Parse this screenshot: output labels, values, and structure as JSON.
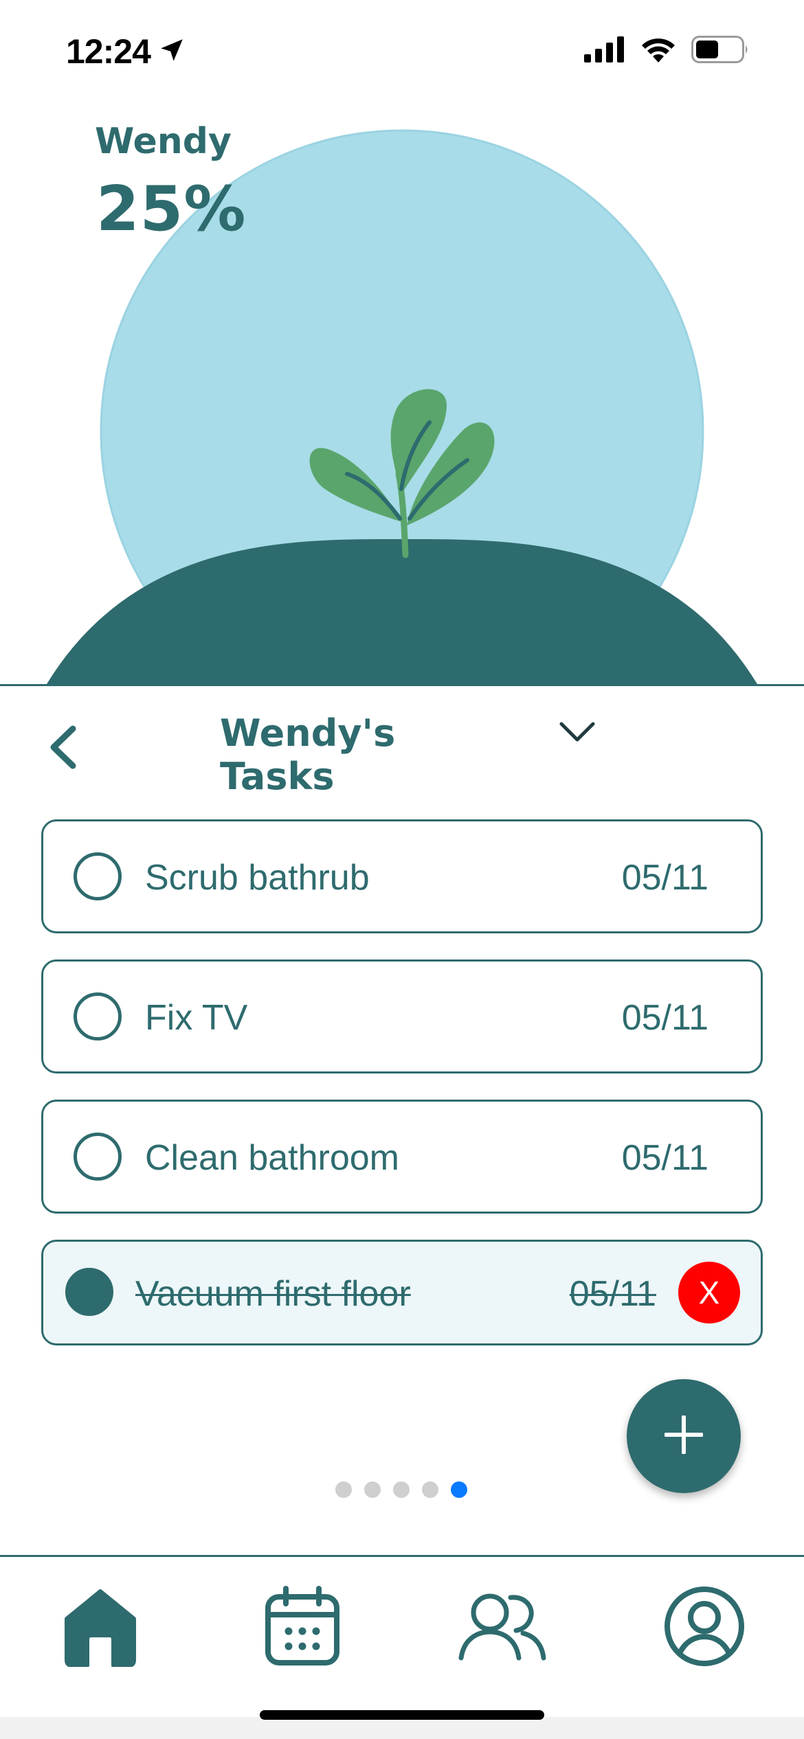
{
  "status_bar": {
    "time": "12:24",
    "icons": [
      "location-arrow-icon",
      "cellular-signal-icon",
      "wifi-icon",
      "battery-icon"
    ]
  },
  "profile": {
    "name": "Wendy",
    "progress_percent_label": "25%",
    "progress_fraction": 0.25
  },
  "tasks_header": {
    "title": "Wendy's Tasks",
    "back_icon": "chevron-left-icon",
    "dropdown_icon": "chevron-down-icon"
  },
  "tasks": [
    {
      "label": "Scrub bathrub",
      "date": "05/11",
      "completed": false
    },
    {
      "label": "Fix TV",
      "date": "05/11",
      "completed": false
    },
    {
      "label": "Clean bathroom",
      "date": "05/11",
      "completed": false
    },
    {
      "label": "Vacuum first floor",
      "date": "05/11",
      "completed": true,
      "delete_label": "X"
    }
  ],
  "pagination": {
    "count": 5,
    "active_index": 4
  },
  "fab": {
    "icon": "plus-icon"
  },
  "tab_bar": {
    "tabs": [
      "home-icon",
      "calendar-icon",
      "group-icon",
      "profile-icon"
    ],
    "active": "home-icon"
  },
  "colors": {
    "primary": "#2e6b6e",
    "sky": "#a8dce8",
    "leaf": "#5aa56c",
    "delete": "#ff0000",
    "active_dot": "#0a7aff"
  }
}
